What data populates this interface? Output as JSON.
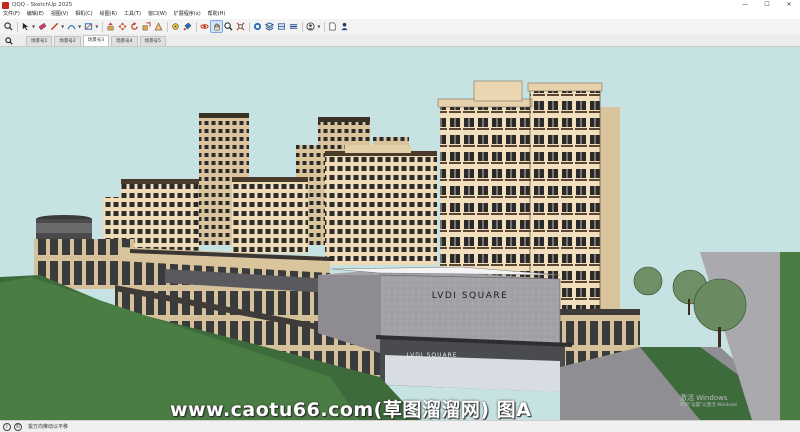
{
  "window": {
    "title": "QQQ - SketchUp 2025",
    "minimize": "—",
    "maximize": "☐",
    "close": "✕"
  },
  "menu": [
    "文件(F)",
    "编辑(E)",
    "视图(V)",
    "相机(C)",
    "绘图(R)",
    "工具(T)",
    "窗口(W)",
    "扩展程序(x)",
    "帮助(H)"
  ],
  "toolbar": {
    "icons": [
      "search-icon",
      "select-icon",
      "eraser-icon",
      "pencil-icon",
      "shape-icon",
      "push-pull-icon",
      "move-icon",
      "rotate-icon",
      "scale-icon",
      "offset-icon",
      "tape-icon",
      "paint-icon",
      "orbit-icon",
      "pan-icon",
      "zoom-icon",
      "zoom-extents-icon",
      "warehouse-icon",
      "extension-icon",
      "layers-icon",
      "styles-icon",
      "user-icon",
      "document-icon",
      "account-icon"
    ]
  },
  "scenes": {
    "tabs": [
      "场景号1",
      "场景号2",
      "场景号3",
      "场景号4",
      "场景号5"
    ],
    "selected_index": 2
  },
  "model": {
    "signage_upper": "LVDI SQUARE",
    "signage_lower": "LVDI SQUARE"
  },
  "overlay": {
    "watermark": "www.caotu66.com(草图溜溜网) 图A",
    "activate_title": "激活 Windows",
    "activate_sub": "转到\"设置\"以激活 Windows"
  },
  "status": {
    "text": "拔方向推动以平移"
  },
  "colors": {
    "sky": "#c7e2e2",
    "grass": "#3e6b3c",
    "facade": "#f0dcb4",
    "window": "#2a2a2a",
    "box": "#a9a8ad"
  }
}
